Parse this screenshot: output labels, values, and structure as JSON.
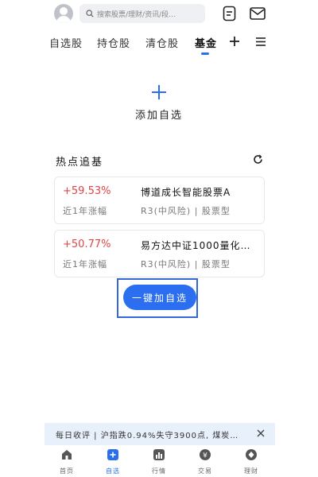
{
  "header": {
    "search_placeholder": "搜索股票/理财/资讯/段…"
  },
  "tabs": [
    {
      "label": "自选股",
      "active": false
    },
    {
      "label": "持仓股",
      "active": false
    },
    {
      "label": "清仓股",
      "active": false
    },
    {
      "label": "基金",
      "active": true
    }
  ],
  "add": {
    "label": "添加自选"
  },
  "hot": {
    "title": "热点追基",
    "funds": [
      {
        "return": "+59.53%",
        "period": "近1年涨幅",
        "name": "博道成长智能股票A",
        "risk": "R3(中风险) | 股票型"
      },
      {
        "return": "+50.77%",
        "period": "近1年涨幅",
        "name": "易方达中证1000量化增…",
        "risk": "R3(中风险) | 股票型"
      }
    ]
  },
  "add_all_label": "一键加自选",
  "ticker": {
    "text": "每日收评 | 沪指跌0.94%失守3900点, 煤炭…"
  },
  "nav": [
    {
      "label": "首页",
      "icon": "home-icon",
      "active": false
    },
    {
      "label": "自选",
      "icon": "add-square-icon",
      "active": true
    },
    {
      "label": "行情",
      "icon": "chart-icon",
      "active": false
    },
    {
      "label": "交易",
      "icon": "yen-icon",
      "active": false
    },
    {
      "label": "理财",
      "icon": "wealth-icon",
      "active": false
    }
  ],
  "colors": {
    "accent": "#2b6ff0",
    "positive": "#e04545",
    "ticker_bg": "#e8f1fb"
  }
}
